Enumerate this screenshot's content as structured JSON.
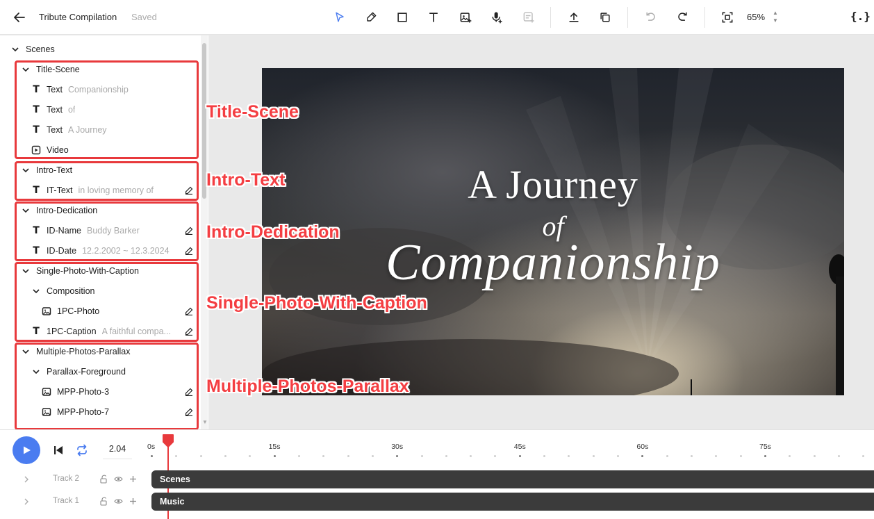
{
  "header": {
    "title": "Tribute Compilation",
    "status": "Saved",
    "zoom": "65%"
  },
  "tree": {
    "root_label": "Scenes",
    "rows": {
      "title_scene": "Title-Scene",
      "text_label": "Text",
      "text1_value": "Companionship",
      "text2_value": "of",
      "text3_value": "A Journey",
      "video_label": "Video",
      "intro_text": "Intro-Text",
      "it_text": "IT-Text",
      "it_text_value": "in loving memory of",
      "intro_dedication": "Intro-Dedication",
      "id_name": "ID-Name",
      "id_name_value": "Buddy Barker",
      "id_date": "ID-Date",
      "id_date_value": "12.2.2002 ~ 12.3.2024",
      "single_photo": "Single-Photo-With-Caption",
      "composition": "Composition",
      "photo_1pc": "1PC-Photo",
      "caption_1pc": "1PC-Caption",
      "caption_1pc_value": "A faithful compa...",
      "multi_photos": "Multiple-Photos-Parallax",
      "parallax_fg": "Parallax-Foreground",
      "mpp3": "MPP-Photo-3",
      "mpp7": "MPP-Photo-7"
    }
  },
  "annotations": {
    "title_scene": "Title-Scene",
    "intro_text": "Intro-Text",
    "intro_dedication": "Intro-Dedication",
    "single_photo": "Single-Photo-With-Caption",
    "multi_photos": "Multiple-Photos-Parallax"
  },
  "preview": {
    "line1": "A Journey",
    "line2": "of",
    "line3": "Companionship"
  },
  "timeline": {
    "timecode": "2.04",
    "ticks": [
      "0s",
      "15s",
      "30s",
      "45s",
      "60s",
      "75s"
    ],
    "tracks": [
      {
        "name": "Track 2",
        "clip": "Scenes"
      },
      {
        "name": "Track 1",
        "clip": "Music"
      }
    ]
  },
  "colors": {
    "accent": "#4a7cf0",
    "highlight": "#e8393c"
  }
}
